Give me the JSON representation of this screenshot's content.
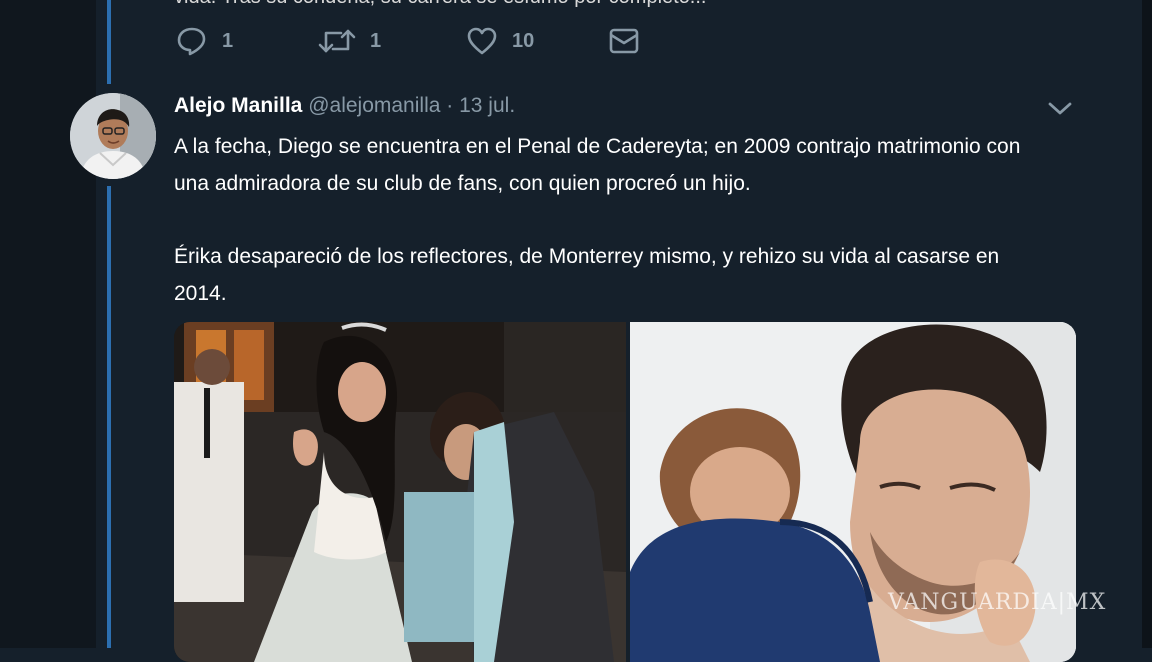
{
  "prev_tweet": {
    "cut_text": "vida. Tras su condena, su carrera se esfumó por completo...",
    "actions": {
      "replies": "1",
      "retweets": "1",
      "likes": "10"
    }
  },
  "tweet": {
    "display_name": "Alejo Manilla",
    "handle": "@alejomanilla",
    "separator": "·",
    "date": "13 jul.",
    "paragraph_1": "A la fecha, Diego se encuentra en el Penal de Cadereyta; en 2009 contrajo matrimonio con una admiradora de su club de fans, con quien procreó un hijo.",
    "paragraph_2": "Érika desapareció de los reflectores, de Monterrey mismo, y rehizo su vida al casarse en 2014."
  },
  "icons": {
    "reply": "reply-icon",
    "retweet": "retweet-icon",
    "like": "heart-icon",
    "dm": "envelope-icon",
    "menu": "chevron-down-icon"
  },
  "watermark": "VANGUARDIA|MX",
  "colors": {
    "background": "#15202b",
    "thread_line": "#2c6fb0",
    "muted_text": "#8899a6"
  }
}
